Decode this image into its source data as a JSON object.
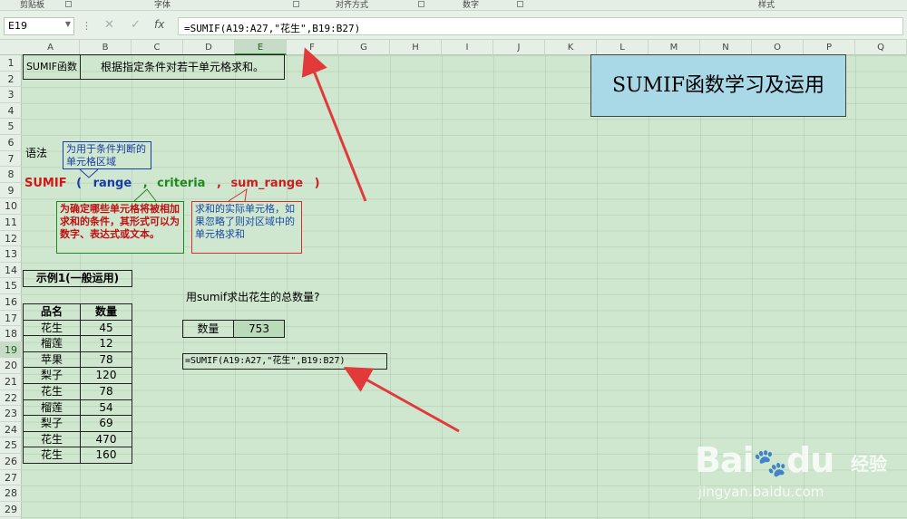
{
  "ribbon": {
    "groups": [
      "剪贴板",
      "字体",
      "对齐方式",
      "数字",
      "样式"
    ]
  },
  "formula_bar": {
    "name_box": "E19",
    "more_icon": "⋮",
    "cancel_icon": "✕",
    "enter_icon": "✓",
    "fx_icon": "fx",
    "formula": "=SUMIF(A19:A27,\"花生\",B19:B27)"
  },
  "columns": [
    "A",
    "B",
    "C",
    "D",
    "E",
    "F",
    "G",
    "H",
    "I",
    "J",
    "K",
    "L",
    "M",
    "N",
    "O",
    "P",
    "Q"
  ],
  "selected_column": "E",
  "rows": [
    "1",
    "2",
    "3",
    "4",
    "5",
    "6",
    "7",
    "8",
    "9",
    "10",
    "11",
    "12",
    "13",
    "14",
    "15",
    "16",
    "17",
    "18",
    "19",
    "20",
    "21",
    "22",
    "23",
    "24",
    "25",
    "26",
    "27",
    "28",
    "29"
  ],
  "selected_row": "19",
  "sheet": {
    "a1_label": "SUMIF函数",
    "b1_desc": "根据指定条件对若干单元格求和。",
    "banner_title": "SUMIF函数学习及运用",
    "syntax_label": "语法",
    "syntax": {
      "fn": "SUMIF",
      "open": "(",
      "range": "range",
      "comma1": ",",
      "criteria": "criteria",
      "comma2": ",",
      "sum_range": "sum_range",
      "close": ")"
    },
    "callout_range": "为用于条件判断的单元格区域",
    "callout_criteria": "为确定哪些单元格将被相加求和的条件，其形式可以为数字、表达式或文本。",
    "callout_sum_range": "求和的实际单元格，如果忽略了则对区域中的单元格求和",
    "example_title": "示例1(一般运用)",
    "table_headers": [
      "品名",
      "数量"
    ],
    "table_rows": [
      [
        "花生",
        "45"
      ],
      [
        "榴莲",
        "12"
      ],
      [
        "苹果",
        "78"
      ],
      [
        "梨子",
        "120"
      ],
      [
        "花生",
        "78"
      ],
      [
        "榴莲",
        "54"
      ],
      [
        "梨子",
        "69"
      ],
      [
        "花生",
        "470"
      ],
      [
        "花生",
        "160"
      ]
    ],
    "question": "用sumif求出花生的总数量?",
    "qty_label": "数量",
    "qty_value": "753",
    "formula_text": "=SUMIF(A19:A27,\"花生\",B19:B27)"
  },
  "watermark": {
    "brand": "Bai",
    "brand2": "du",
    "cn": "经验",
    "url": "jingyan.baidu.com"
  },
  "colors": {
    "sheet_bg": "#cfe6cf",
    "sumif_red": "#d01818",
    "range_blue": "#1a3aa8",
    "criteria_green": "#1e8a1e",
    "sum_range_red": "#c81e1e",
    "banner_bg": "#a9d8e6",
    "arrow_red": "#e23a3a",
    "value_cell_bg": "#b9dbb9"
  }
}
